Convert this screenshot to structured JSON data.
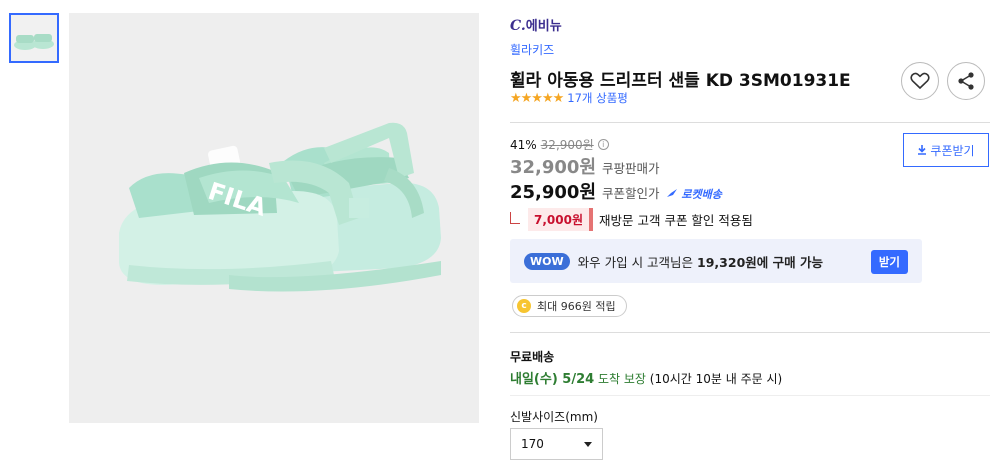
{
  "brand": {
    "logo_text": "에비뉴",
    "logo_c": "C.",
    "store_link": "휠라키즈"
  },
  "product": {
    "title": "휠라 아동용 드리프터 샌들 KD 3SM01931E",
    "stars": "★★★★★",
    "rating_value": 5,
    "review_count": "17개 상품평",
    "product_color": "#b9e6d3"
  },
  "pricing": {
    "discount_rate": "41%",
    "original_price": "32,900원",
    "info_icon": "i",
    "coupang_price": "32,900원",
    "coupang_price_label": "쿠팡판매가",
    "coupon_price": "25,900원",
    "coupon_price_label": "쿠폰할인가",
    "rocket_label": "로켓배송",
    "coupon_button": "쿠폰받기",
    "revisit_amount": "7,000원",
    "revisit_text": "재방문 고객 쿠폰 할인 적용됨"
  },
  "wow": {
    "badge": "WOW",
    "text_prefix": "와우 가입 시 고객님은 ",
    "price": "19,320원에 구매 가능",
    "button": "받기"
  },
  "cashback": {
    "coin": "c",
    "text": "최대 966원 적립"
  },
  "shipping": {
    "title": "무료배송",
    "date": "내일(수) 5/24",
    "guarantee": " 도착 보장",
    "note": " (10시간 10분 내 주문 시)"
  },
  "options": {
    "size_label": "신발사이즈(mm)",
    "size_value": "170"
  },
  "colors": {
    "accent": "#346aff",
    "wow": "#3b6fd8",
    "green": "#2e7d32",
    "red": "#c8102e",
    "star": "#f5a623"
  }
}
